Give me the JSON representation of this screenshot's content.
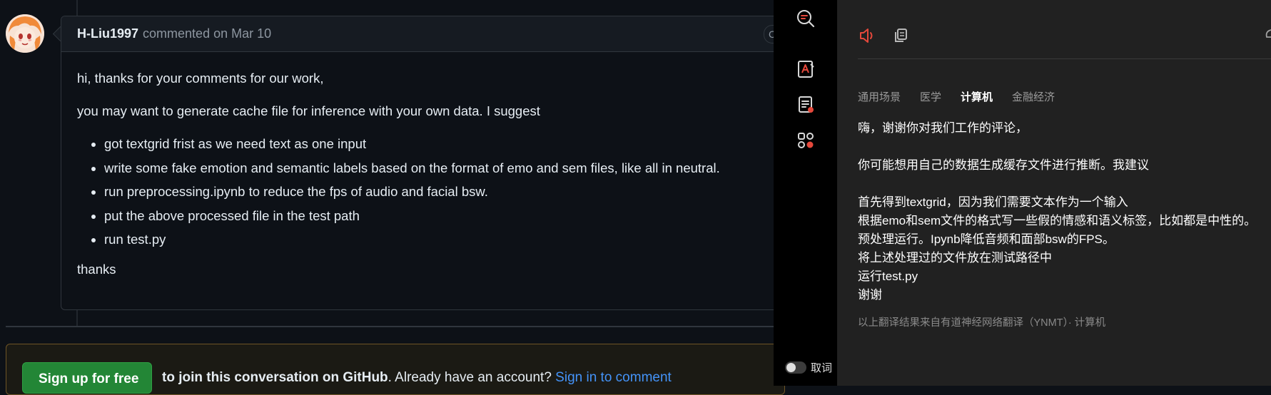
{
  "github": {
    "comment": {
      "author": "H-Liu1997",
      "meta": "commented on Mar 10",
      "header_button": "C",
      "body_line1": "hi, thanks for your comments for our work,",
      "body_line2": "you may want to generate cache file for inference with your own data. I suggest",
      "list": [
        "got textgrid frist as we need text as one input",
        "write some fake emotion and semantic labels based on the format of emo and sem files, like all in neutral.",
        "run preprocessing.ipynb to reduce the fps of audio and facial bsw.",
        "put the above processed file in the test path",
        "run test.py"
      ],
      "closing": "thanks"
    },
    "signup": {
      "button_label": "Sign up for free",
      "join_text": "to join this conversation on GitHub",
      "account_text": ". Already have an account? ",
      "signin_link": "Sign in to comment"
    },
    "colors": {
      "link": "#4493f8",
      "signup_button": "#238636",
      "banner_border": "#6e5526"
    }
  },
  "iconbar": {
    "icons": [
      "search-translate-icon",
      "document-translate-icon",
      "notes-icon",
      "apps-icon"
    ],
    "toggle_label": "取词"
  },
  "translation_panel": {
    "toolbar_icons": [
      "speaker-icon",
      "copy-icon"
    ],
    "tabs": [
      "通用场景",
      "医学",
      "计算机",
      "金融经济"
    ],
    "active_tab": "计算机",
    "lines": [
      "嗨，谢谢你对我们工作的评论，",
      "",
      "你可能想用自己的数据生成缓存文件进行推断。我建议",
      "",
      "首先得到textgrid，因为我们需要文本作为一个输入",
      "根据emo和sem文件的格式写一些假的情感和语义标签，比如都是中性的。",
      "预处理运行。Ipynb降低音频和面部bsw的FPS。",
      "将上述处理过的文件放在测试路径中",
      "运行test.py",
      "谢谢"
    ],
    "footnote": "以上翻译结果来自有道神经网络翻译（YNMT）· 计算机",
    "colors": {
      "speaker_icon": "#e5483b"
    }
  }
}
